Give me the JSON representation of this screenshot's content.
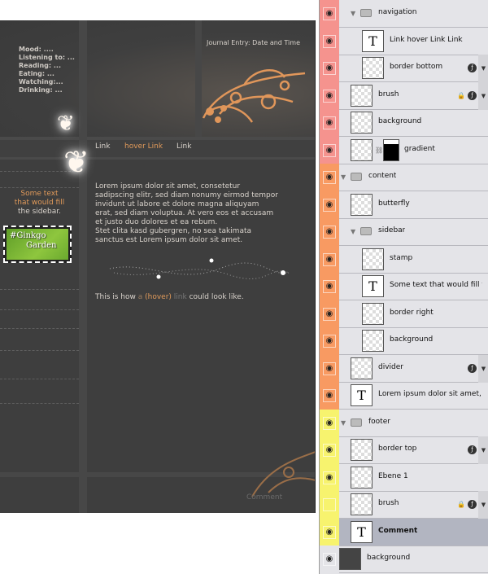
{
  "canvas": {
    "status_lines": [
      "Mood: ....",
      "Listening to: ...",
      "Reading: ...",
      "Eating: ...",
      "Watching:...",
      "Drinking: ..."
    ],
    "journal_entry": "Journal Entry: Date and Time",
    "nav": [
      "Link",
      "hover Link",
      "Link"
    ],
    "sidebar_text": {
      "line1": "Some text",
      "line2": "that would fill",
      "line3": "the sidebar."
    },
    "stamp_text": {
      "line1": "#Ginkgo",
      "line2": "Garden"
    },
    "body_lines": [
      "Lorem ipsum dolor sit amet, consetetur",
      "sadipscing elitr, sed diam nonumy eirmod tempor",
      "invidunt ut labore et dolore magna aliquyam",
      "erat, sed diam voluptua. At vero eos et accusam",
      "et justo duo dolores et ea rebum.",
      "Stet clita kasd gubergren, no sea takimata",
      "sanctus est Lorem ipsum dolor sit amet."
    ],
    "link_line": {
      "pre": "This is how ",
      "a": "a",
      "hover": "(hover)",
      "link": "link",
      "post": " could look like."
    },
    "footer_comment": "Comment",
    "colors": {
      "background": "#3e3e3e",
      "accent": "#e19a5a",
      "text": "#d9d3cc"
    }
  },
  "layers": [
    {
      "name": "navigation",
      "type": "group",
      "level": 1,
      "visible": true,
      "color": "#f5938e"
    },
    {
      "name": "Link      hover Link    Link",
      "type": "text",
      "level": 2,
      "visible": true,
      "color": "#f5938e"
    },
    {
      "name": "border bottom",
      "type": "pixel",
      "level": 2,
      "visible": true,
      "fx": true,
      "color": "#f5938e"
    },
    {
      "name": "brush",
      "type": "pixel",
      "level": 1,
      "visible": true,
      "fx": true,
      "locked": true,
      "color": "#f5938e"
    },
    {
      "name": "background",
      "type": "pixel",
      "level": 1,
      "visible": true,
      "color": "#f5938e"
    },
    {
      "name": "gradient",
      "type": "masked",
      "level": 1,
      "visible": true,
      "color": "#f5938e"
    },
    {
      "name": "content",
      "type": "group",
      "level": 0,
      "visible": true,
      "color": "#f89a62"
    },
    {
      "name": "butterfly",
      "type": "pixel",
      "level": 1,
      "visible": true,
      "color": "#f89a62"
    },
    {
      "name": "sidebar",
      "type": "group",
      "level": 1,
      "visible": true,
      "color": "#f89a62"
    },
    {
      "name": "stamp",
      "type": "pixel",
      "level": 2,
      "visible": true,
      "color": "#f89a62"
    },
    {
      "name": "Some text that would fill the",
      "type": "text",
      "level": 2,
      "visible": true,
      "color": "#f89a62"
    },
    {
      "name": "border right",
      "type": "pixel",
      "level": 2,
      "visible": true,
      "color": "#f89a62"
    },
    {
      "name": "background",
      "type": "pixel",
      "level": 2,
      "visible": true,
      "color": "#f89a62"
    },
    {
      "name": "divider",
      "type": "pixel",
      "level": 1,
      "visible": true,
      "fx": true,
      "color": "#f89a62"
    },
    {
      "name": "Lorem ipsum dolor sit amet, co",
      "type": "text",
      "level": 1,
      "visible": true,
      "color": "#f89a62"
    },
    {
      "name": "footer",
      "type": "group",
      "level": 0,
      "visible": true,
      "color": "#f7f36e"
    },
    {
      "name": "border top",
      "type": "pixel",
      "level": 1,
      "visible": true,
      "fx": true,
      "color": "#f7f36e"
    },
    {
      "name": "Ebene 1",
      "type": "pixel",
      "level": 1,
      "visible": true,
      "color": "#f7f36e"
    },
    {
      "name": "brush",
      "type": "pixel",
      "level": 1,
      "visible": false,
      "fx": true,
      "locked": true,
      "color": "#f7f36e"
    },
    {
      "name": "Comment",
      "type": "text",
      "level": 1,
      "visible": true,
      "selected": true,
      "color": "#f7f36e"
    },
    {
      "name": "background",
      "type": "dark",
      "level": 0,
      "visible": true,
      "color": "#e4e4e8"
    }
  ]
}
